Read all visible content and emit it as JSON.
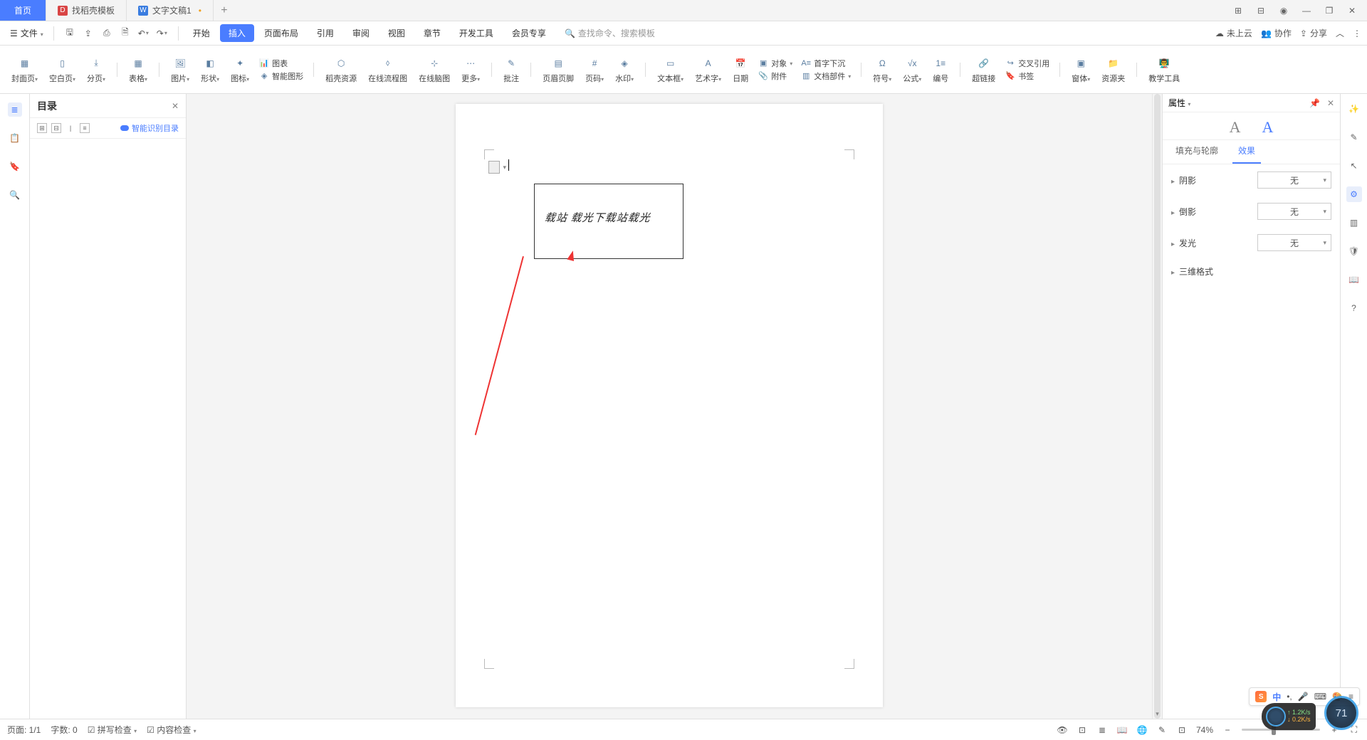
{
  "tabs": {
    "home": "首页",
    "t1": "找稻壳模板",
    "t2": "文字文稿1",
    "modified": "•",
    "add": "+"
  },
  "winctrl": {
    "grid1": "⊞",
    "grid2": "⊟",
    "avatar": "◉",
    "min": "—",
    "max": "❐",
    "close": "✕"
  },
  "menu": {
    "file": "文件",
    "tabs": [
      "开始",
      "插入",
      "页面布局",
      "引用",
      "审阅",
      "视图",
      "章节",
      "开发工具",
      "会员专享"
    ],
    "active_index": 1,
    "search_placeholder": "查找命令、搜索模板"
  },
  "rightmenu": {
    "cloud": "未上云",
    "collab": "协作",
    "share": "分享"
  },
  "ribbon": {
    "items": [
      "封面页",
      "空白页",
      "分页",
      "表格",
      "图片",
      "形状",
      "图标",
      "智能图形",
      "稻壳资源",
      "在线流程图",
      "在线脑图",
      "更多",
      "批注",
      "页眉页脚",
      "页码",
      "水印",
      "文本框",
      "艺术字",
      "日期",
      "符号",
      "公式",
      "编号",
      "超链接",
      "窗体",
      "资源夹",
      "教学工具"
    ],
    "smallgroups": {
      "chart": "图表",
      "object": "对象",
      "attach": "附件",
      "docparts": "文档部件",
      "dropcap": "首字下沉",
      "crossref": "交叉引用",
      "bookmark": "书签"
    }
  },
  "nav": {
    "title": "目录",
    "close": "✕",
    "smart": "智能识别目录"
  },
  "properties": {
    "title": "属性",
    "tab_fill": "填充与轮廓",
    "tab_effect": "效果",
    "rows": {
      "shadow": "阴影",
      "reflection": "倒影",
      "glow": "发光",
      "threed": "三维格式"
    },
    "none": "无"
  },
  "status": {
    "page": "页面: 1/1",
    "words": "字数: 0",
    "spell": "拼写检查",
    "content": "内容检查",
    "zoom": "74%"
  },
  "float": {
    "ime_zh": "中",
    "net_up": "1.2K/s",
    "net_dn": "0.2K/s",
    "cpu": "71"
  },
  "art_text": "载站 载光下载站载光"
}
